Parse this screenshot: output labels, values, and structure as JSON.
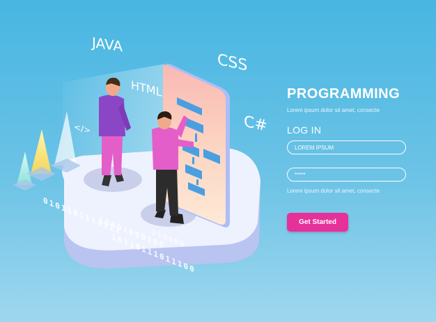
{
  "panel": {
    "title": "PROGRAMMING",
    "subtitle": "Lorem ipsum dolor sit amet, consecte",
    "login_label": "LOG IN",
    "username_value": "LOREM IPSUM",
    "password_value": "*****",
    "hint": "Lorem ipsum dolor sit amet, consecte",
    "button_label": "Get Started"
  },
  "illustration": {
    "tags": {
      "java": "JAVA",
      "html": "HTML",
      "css": "CSS",
      "csharp": "C#",
      "code": "</>"
    },
    "binary": [
      "0101101110111",
      "10001000100",
      "10110111011100"
    ],
    "binary_extra": "110000"
  },
  "colors": {
    "background": "#5bbde4",
    "accent": "#e6309a",
    "text": "#ffffff"
  }
}
